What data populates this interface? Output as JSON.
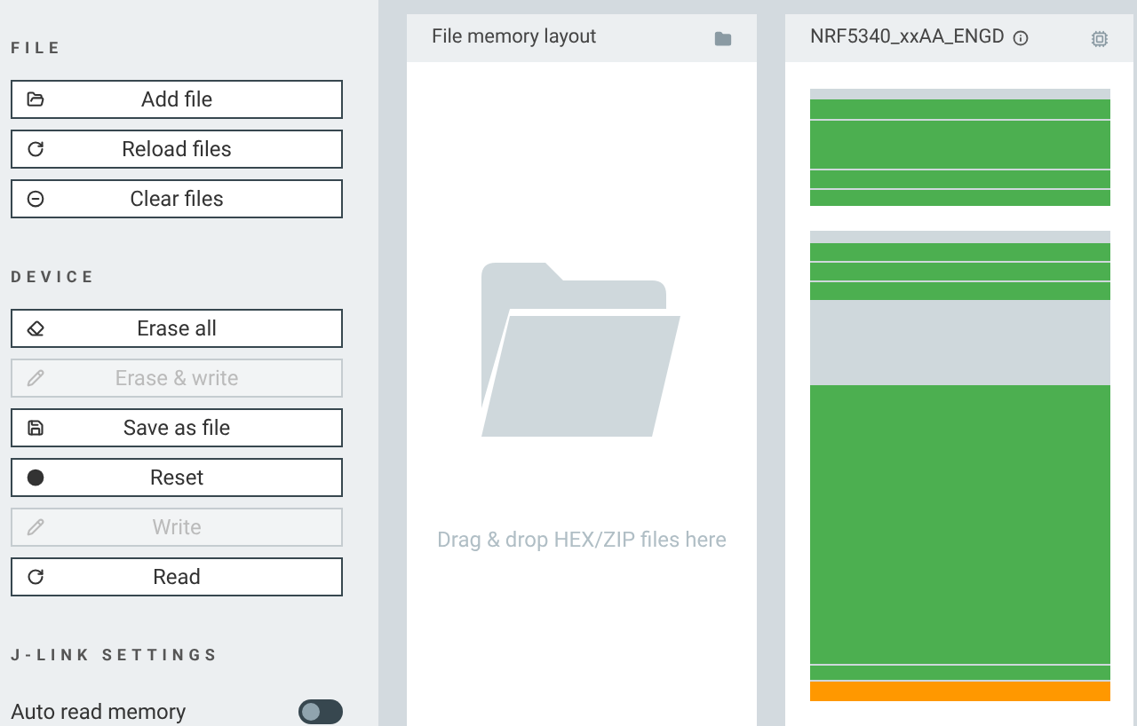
{
  "sidebar": {
    "sections": [
      {
        "title": "FILE",
        "buttons": [
          {
            "label": "Add file",
            "disabled": false
          },
          {
            "label": "Reload files",
            "disabled": false
          },
          {
            "label": "Clear files",
            "disabled": false
          }
        ]
      },
      {
        "title": "DEVICE",
        "buttons": [
          {
            "label": "Erase all",
            "disabled": false
          },
          {
            "label": "Erase & write",
            "disabled": true
          },
          {
            "label": "Save as file",
            "disabled": false
          },
          {
            "label": "Reset",
            "disabled": false
          },
          {
            "label": "Write",
            "disabled": true
          },
          {
            "label": "Read",
            "disabled": false
          }
        ]
      },
      {
        "title": "J-LINK SETTINGS",
        "toggles": [
          {
            "label": "Auto read memory",
            "on": false
          }
        ]
      }
    ]
  },
  "file_panel": {
    "title": "File memory layout",
    "hint": "Drag & drop HEX/ZIP files here"
  },
  "device_panel": {
    "title": "NRF5340_xxAA_ENGD",
    "regions": [
      {
        "segments": [
          {
            "color": "#cfd8dc"
          },
          {
            "color": "#4caf50"
          },
          {
            "color": "#4caf50"
          },
          {
            "color": "#4caf50"
          },
          {
            "color": "#4caf50"
          }
        ]
      },
      {
        "segments": [
          {
            "color": "#cfd8dc"
          },
          {
            "color": "#4caf50"
          },
          {
            "color": "#4caf50"
          },
          {
            "color": "#4caf50"
          },
          {
            "color": "#cfd8dc"
          },
          {
            "color": "#4caf50"
          },
          {
            "color": "#4caf50"
          },
          {
            "color": "#ff9800"
          }
        ]
      }
    ]
  }
}
